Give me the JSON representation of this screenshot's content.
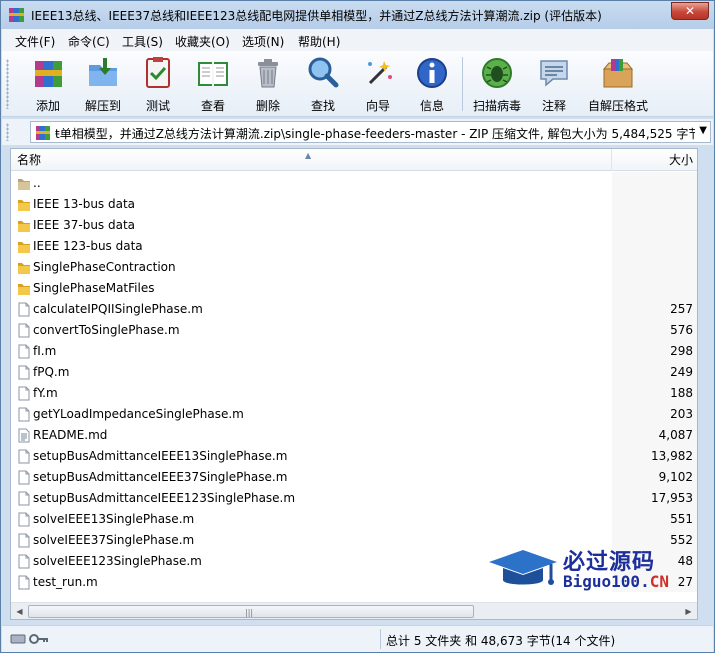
{
  "window": {
    "title": "IEEE13总线、IEEE37总线和IEEE123总线配电网提供单相模型，并通过Z总线方法计算潮流.zip (评估版本)",
    "close_label": "✕"
  },
  "menu": [
    "文件(F)",
    "命令(C)",
    "工具(S)",
    "收藏夹(O)",
    "选项(N)",
    "帮助(H)"
  ],
  "toolbar": [
    {
      "label": "添加",
      "icon": "add-archive-icon"
    },
    {
      "label": "解压到",
      "icon": "extract-to-icon"
    },
    {
      "label": "测试",
      "icon": "test-icon"
    },
    {
      "label": "查看",
      "icon": "view-book-icon"
    },
    {
      "label": "删除",
      "icon": "delete-trash-icon"
    },
    {
      "label": "查找",
      "icon": "find-magnifier-icon"
    },
    {
      "label": "向导",
      "icon": "wizard-wand-icon"
    },
    {
      "label": "信息",
      "icon": "info-icon"
    },
    {
      "label": "扫描病毒",
      "icon": "virus-scan-icon"
    },
    {
      "label": "注释",
      "icon": "comment-icon"
    },
    {
      "label": "自解压格式",
      "icon": "sfx-box-icon"
    }
  ],
  "address": {
    "path": "ŧ单相模型，并通过Z总线方法计算潮流.zip\\single-phase-feeders-master - ZIP 压缩文件, 解包大小为 5,484,525 字节"
  },
  "list": {
    "col_name": "名称",
    "col_size": "大小",
    "rows": [
      {
        "name": "..",
        "size": "",
        "type": "up"
      },
      {
        "name": "IEEE 13-bus data",
        "size": "",
        "type": "folder"
      },
      {
        "name": "IEEE 37-bus data",
        "size": "",
        "type": "folder"
      },
      {
        "name": "IEEE 123-bus data",
        "size": "",
        "type": "folder"
      },
      {
        "name": "SinglePhaseContraction",
        "size": "",
        "type": "folder"
      },
      {
        "name": "SinglePhaseMatFiles",
        "size": "",
        "type": "folder"
      },
      {
        "name": "calculateIPQIISinglePhase.m",
        "size": "257",
        "type": "file"
      },
      {
        "name": "convertToSinglePhase.m",
        "size": "576",
        "type": "file"
      },
      {
        "name": "fI.m",
        "size": "298",
        "type": "file"
      },
      {
        "name": "fPQ.m",
        "size": "249",
        "type": "file"
      },
      {
        "name": "fY.m",
        "size": "188",
        "type": "file"
      },
      {
        "name": "getYLoadImpedanceSinglePhase.m",
        "size": "203",
        "type": "file"
      },
      {
        "name": "README.md",
        "size": "4,087",
        "type": "doc"
      },
      {
        "name": "setupBusAdmittanceIEEE13SinglePhase.m",
        "size": "13,982",
        "type": "file"
      },
      {
        "name": "setupBusAdmittanceIEEE37SinglePhase.m",
        "size": "9,102",
        "type": "file"
      },
      {
        "name": "setupBusAdmittanceIEEE123SinglePhase.m",
        "size": "17,953",
        "type": "file"
      },
      {
        "name": "solveIEEE13SinglePhase.m",
        "size": "551",
        "type": "file"
      },
      {
        "name": "solveIEEE37SinglePhase.m",
        "size": "552",
        "type": "file"
      },
      {
        "name": "solveIEEE123SinglePhase.m",
        "size": "48",
        "type": "file"
      },
      {
        "name": "test_run.m",
        "size": "27",
        "type": "file"
      }
    ]
  },
  "status": {
    "summary": "总计 5 文件夹 和 48,673 字节(14 个文件)"
  },
  "watermark": {
    "title": "必过源码",
    "url_main": "Biguo100.",
    "url_cn": "CN"
  }
}
